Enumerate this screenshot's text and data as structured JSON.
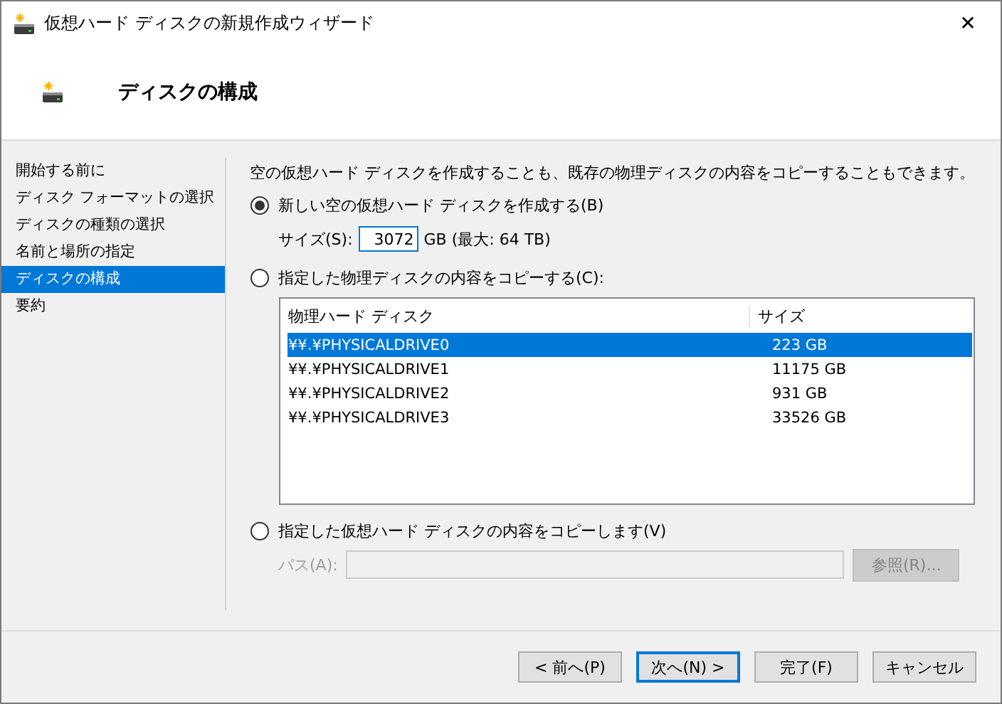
{
  "window": {
    "title": "仮想ハード ディスクの新規作成ウィザード",
    "close": "✕"
  },
  "header": {
    "title": "ディスクの構成"
  },
  "steps": [
    {
      "label": "開始する前に",
      "selected": false
    },
    {
      "label": "ディスク フォーマットの選択",
      "selected": false
    },
    {
      "label": "ディスクの種類の選択",
      "selected": false
    },
    {
      "label": "名前と場所の指定",
      "selected": false
    },
    {
      "label": "ディスクの構成",
      "selected": true
    },
    {
      "label": "要約",
      "selected": false
    }
  ],
  "intro": "空の仮想ハード ディスクを作成することも、既存の物理ディスクの内容をコピーすることもできます。",
  "options": [
    {
      "kind": "new",
      "label": "新しい空の仮想ハード ディスクを作成する(B)",
      "selected": true,
      "size_label": "サイズ(S):",
      "size_value": "3072",
      "size_unit": "GB (最大: 64 TB)"
    },
    {
      "kind": "physical",
      "label": "指定した物理ディスクの内容をコピーする(C):",
      "selected": false,
      "table": {
        "columns": [
          "物理ハード ディスク",
          "サイズ"
        ],
        "rows": [
          {
            "cells": [
              "¥¥.¥PHYSICALDRIVE0",
              "223 GB"
            ],
            "selected": true
          },
          {
            "cells": [
              "¥¥.¥PHYSICALDRIVE1",
              "11175 GB"
            ],
            "selected": false
          },
          {
            "cells": [
              "¥¥.¥PHYSICALDRIVE2",
              "931 GB"
            ],
            "selected": false
          },
          {
            "cells": [
              "¥¥.¥PHYSICALDRIVE3",
              "33526 GB"
            ],
            "selected": false
          }
        ]
      }
    },
    {
      "kind": "virtual",
      "label": "指定した仮想ハード ディスクの内容をコピーします(V)",
      "selected": false,
      "path_label": "パス(A):",
      "browse": "参照(R)...",
      "disabled": true
    }
  ],
  "buttons": [
    {
      "label": "< 前へ(P)",
      "focused": false
    },
    {
      "label": "次へ(N) >",
      "focused": true
    },
    {
      "label": "完了(F)",
      "focused": false
    },
    {
      "label": "キャンセル",
      "focused": false
    }
  ]
}
